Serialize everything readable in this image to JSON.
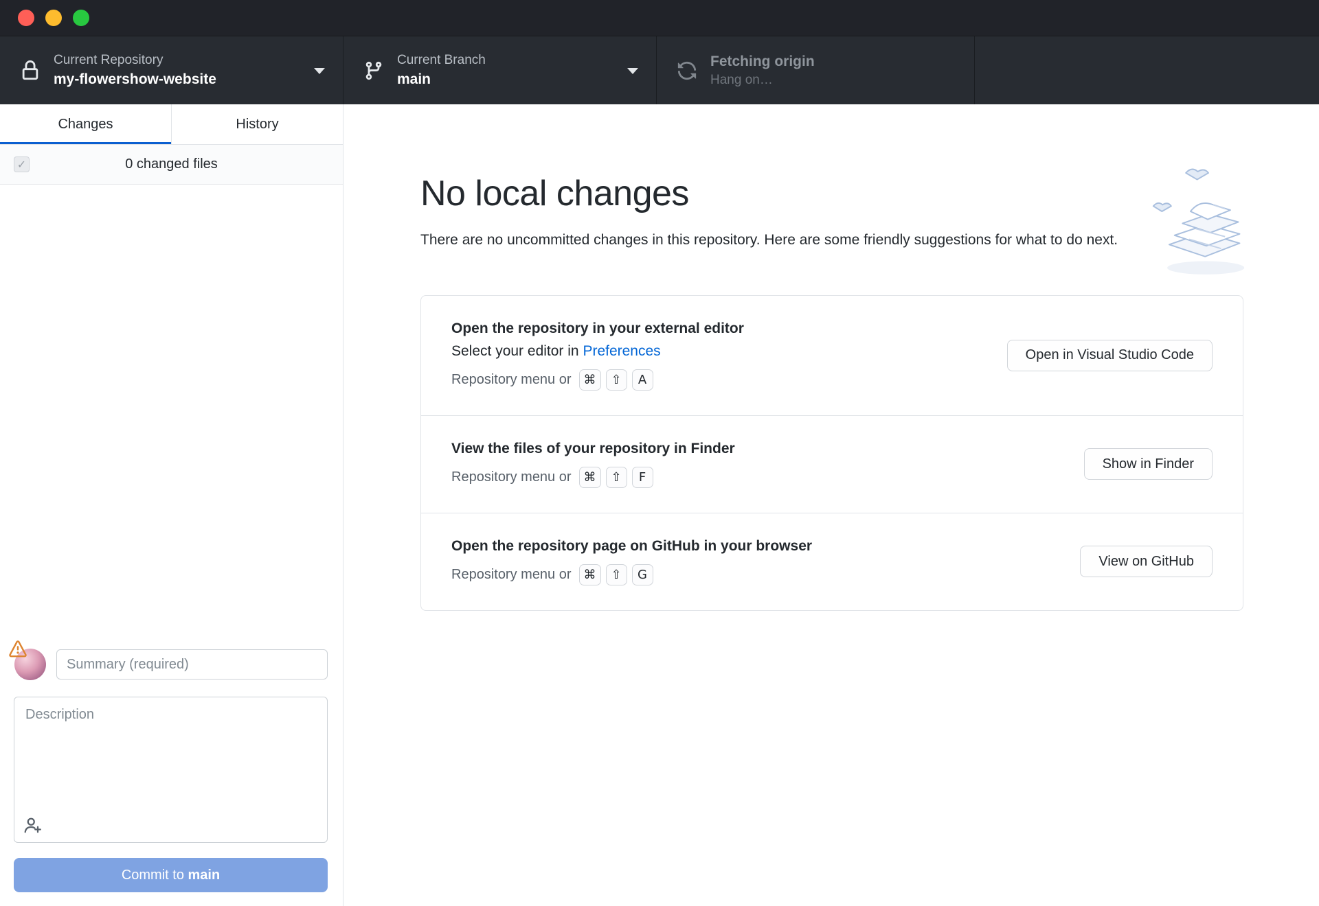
{
  "titlebar": {
    "close": "close",
    "minimize": "minimize",
    "zoom": "zoom"
  },
  "toolbar": {
    "repository": {
      "label": "Current Repository",
      "value": "my-flowershow-website"
    },
    "branch": {
      "label": "Current Branch",
      "value": "main"
    },
    "fetch": {
      "label": "Fetching origin",
      "sublabel": "Hang on…"
    }
  },
  "sidebar": {
    "tabs": [
      {
        "label": "Changes",
        "active": true
      },
      {
        "label": "History",
        "active": false
      }
    ],
    "changed_files": "0 changed files",
    "checkbox_check": "✓",
    "commit": {
      "summary_placeholder": "Summary (required)",
      "description_placeholder": "Description",
      "button_prefix": "Commit to ",
      "button_branch": "main"
    }
  },
  "main": {
    "title": "No local changes",
    "subtitle": "There are no uncommitted changes in this repository. Here are some friendly suggestions for what to do next.",
    "suggestions": [
      {
        "title": "Open the repository in your external editor",
        "subtitle_prefix": "Select your editor in ",
        "subtitle_link": "Preferences",
        "shortcut_label": "Repository menu or",
        "keys": [
          "⌘",
          "⇧",
          "A"
        ],
        "button": "Open in Visual Studio Code"
      },
      {
        "title": "View the files of your repository in Finder",
        "shortcut_label": "Repository menu or",
        "keys": [
          "⌘",
          "⇧",
          "F"
        ],
        "button": "Show in Finder"
      },
      {
        "title": "Open the repository page on GitHub in your browser",
        "shortcut_label": "Repository menu or",
        "keys": [
          "⌘",
          "⇧",
          "G"
        ],
        "button": "View on GitHub"
      }
    ]
  },
  "colors": {
    "toolbar_bg": "#282c32",
    "titlebar_bg": "#212329",
    "accent_blue": "#0366d6",
    "tab_underline": "#0b5fd0",
    "commit_button_disabled": "#7fa3e2",
    "warning_orange": "#dd8430",
    "border_gray": "#e1e4e8",
    "illustration_blue": "#a9bfde"
  }
}
